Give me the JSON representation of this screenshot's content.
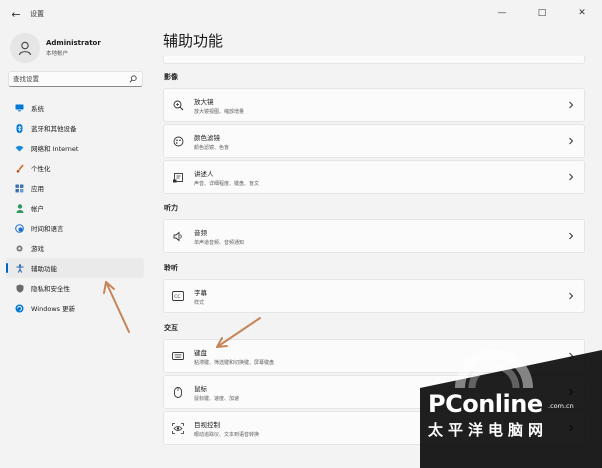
{
  "window": {
    "back_glyph": "←",
    "title": "设置",
    "controls": {
      "minimize": "—",
      "maximize": "□",
      "close": "✕"
    }
  },
  "profile": {
    "name": "Administrator",
    "subtitle": "本地帐户"
  },
  "search": {
    "placeholder": "查找设置"
  },
  "sidebar": {
    "items": [
      {
        "label": "系统",
        "icon": "monitor-icon",
        "color": "#0078d4"
      },
      {
        "label": "蓝牙和其他设备",
        "icon": "bluetooth-icon",
        "color": "#0078d4"
      },
      {
        "label": "网络和 Internet",
        "icon": "wifi-icon",
        "color": "#1a8ae0"
      },
      {
        "label": "个性化",
        "icon": "brush-icon",
        "color": "#d46a1a"
      },
      {
        "label": "应用",
        "icon": "apps-icon",
        "color": "#3a6fb0"
      },
      {
        "label": "帐户",
        "icon": "person-icon",
        "color": "#2e9a5e"
      },
      {
        "label": "时间和语言",
        "icon": "globe-clock-icon",
        "color": "#1a6fd0"
      },
      {
        "label": "游戏",
        "icon": "gamepad-icon",
        "color": "#777777"
      },
      {
        "label": "辅助功能",
        "icon": "accessibility-icon",
        "color": "#1a5fb0",
        "active": true
      },
      {
        "label": "隐私和安全性",
        "icon": "shield-icon",
        "color": "#6a6a6a"
      },
      {
        "label": "Windows 更新",
        "icon": "update-icon",
        "color": "#0078d4"
      }
    ]
  },
  "main": {
    "title": "辅助功能",
    "sections": [
      {
        "title": "影像",
        "cards": [
          {
            "title": "放大镜",
            "subtitle": "放大镜视图、缩放增量",
            "icon": "magnifier-icon"
          },
          {
            "title": "颜色滤镜",
            "subtitle": "颜色滤镜、色盲",
            "icon": "color-filter-icon"
          },
          {
            "title": "讲述人",
            "subtitle": "声音、详细程度、键盘、盲文",
            "icon": "narrator-icon"
          }
        ]
      },
      {
        "title": "听力",
        "cards": [
          {
            "title": "音频",
            "subtitle": "单声道音频、音频通知",
            "icon": "speaker-icon"
          }
        ]
      },
      {
        "title": "聆听",
        "cards": [
          {
            "title": "字幕",
            "subtitle": "样式",
            "icon": "captions-icon"
          }
        ]
      },
      {
        "title": "交互",
        "cards": [
          {
            "title": "键盘",
            "subtitle": "粘滞键、筛选键和切换键、屏幕键盘",
            "icon": "keyboard-icon"
          },
          {
            "title": "鼠标",
            "subtitle": "鼠标键、速度、加速",
            "icon": "mouse-icon"
          },
          {
            "title": "目视控制",
            "subtitle": "眼动追踪仪、文本到语音转换",
            "icon": "eye-control-icon"
          }
        ]
      }
    ]
  },
  "annotations": {
    "arrow_color": "#c7855a"
  },
  "watermark": {
    "brand": "PConline",
    "domain": ".com.cn",
    "cn": "太平洋电脑网"
  }
}
